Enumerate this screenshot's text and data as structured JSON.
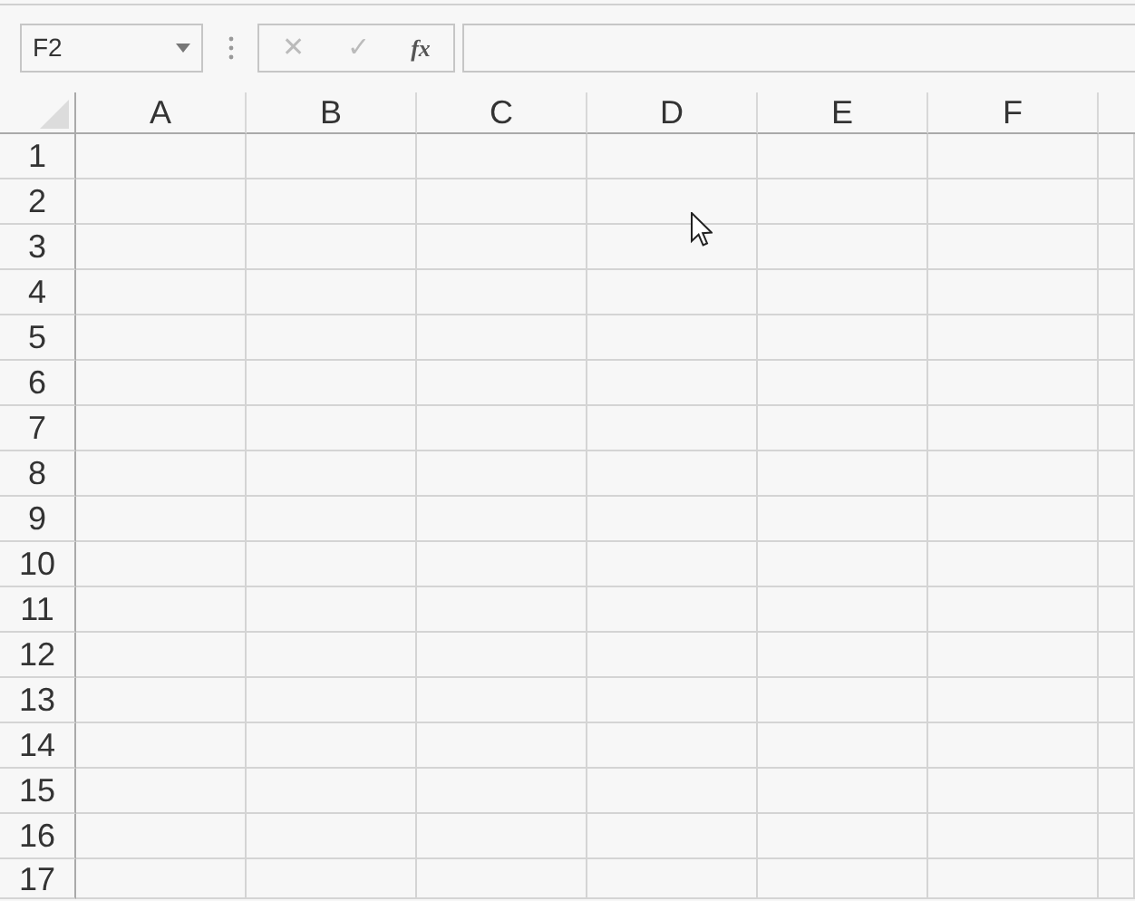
{
  "name_box": {
    "value": "F2"
  },
  "formula_bar": {
    "cancel": "✕",
    "enter": "✓",
    "function": "fx"
  },
  "sheet": {
    "columns": [
      "A",
      "B",
      "C",
      "D",
      "E",
      "F"
    ],
    "rows": [
      "1",
      "2",
      "3",
      "4",
      "5",
      "6",
      "7",
      "8",
      "9",
      "10",
      "11",
      "12",
      "13",
      "14",
      "15",
      "16",
      "17"
    ]
  }
}
